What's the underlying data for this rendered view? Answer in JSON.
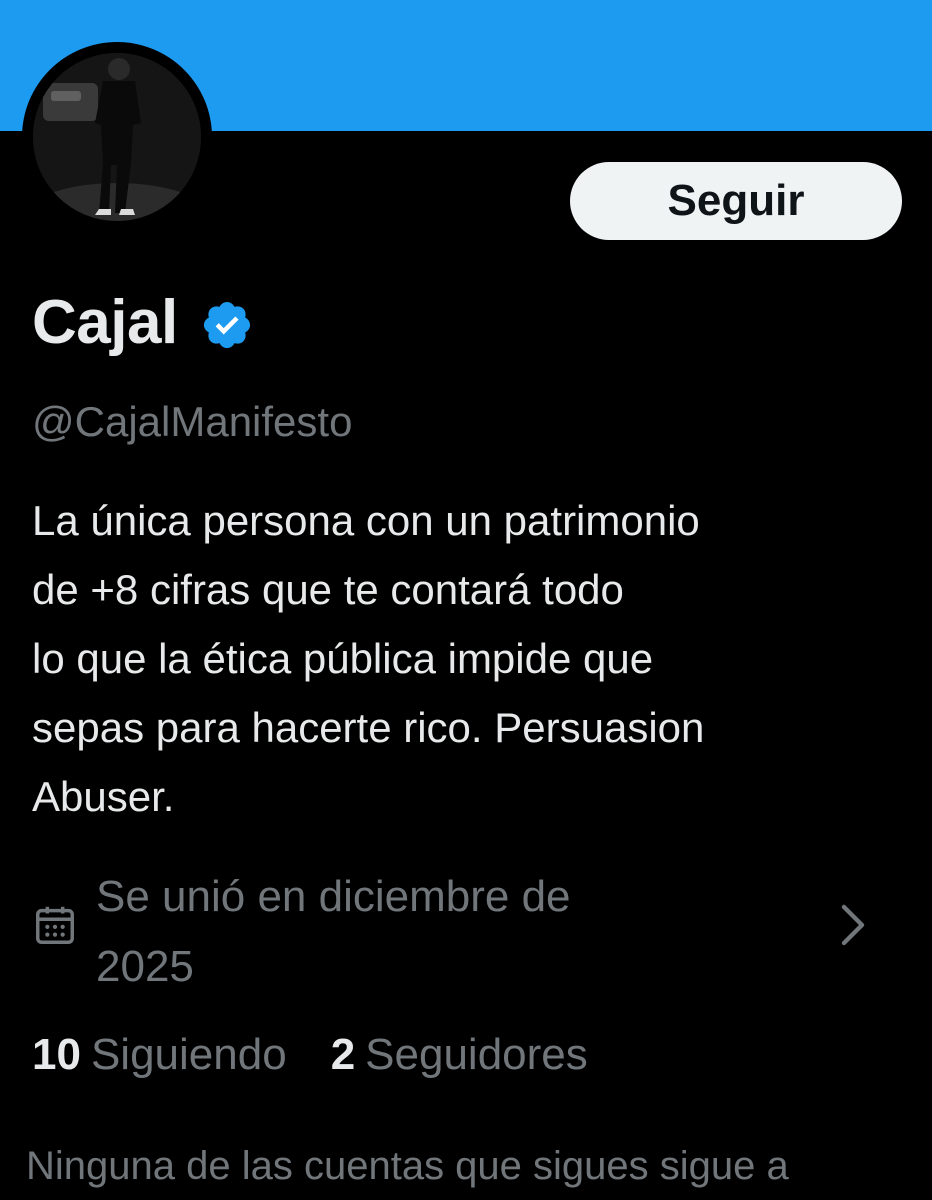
{
  "profile": {
    "display_name": "Cajal",
    "handle": "@CajalManifesto",
    "verified_icon": "verified-badge-icon",
    "verified_color": "#1d9bf0",
    "banner_color": "#1d9bf0",
    "bio_lines": [
      "La única persona con un patrimonio",
      "de +8 cifras que te contará todo",
      "lo que la ética pública impide que",
      "sepas para hacerte rico. Persuasion",
      "Abuser."
    ],
    "joined_lines": [
      "Se unió en diciembre de",
      "2025"
    ],
    "joined_icon": "calendar-icon"
  },
  "actions": {
    "follow_label": "Seguir"
  },
  "stats": {
    "following_count": "10",
    "following_label": "Siguiendo",
    "followers_count": "2",
    "followers_label": "Seguidores"
  },
  "footnote": "Ninguna de las cuentas que sigues sigue a"
}
